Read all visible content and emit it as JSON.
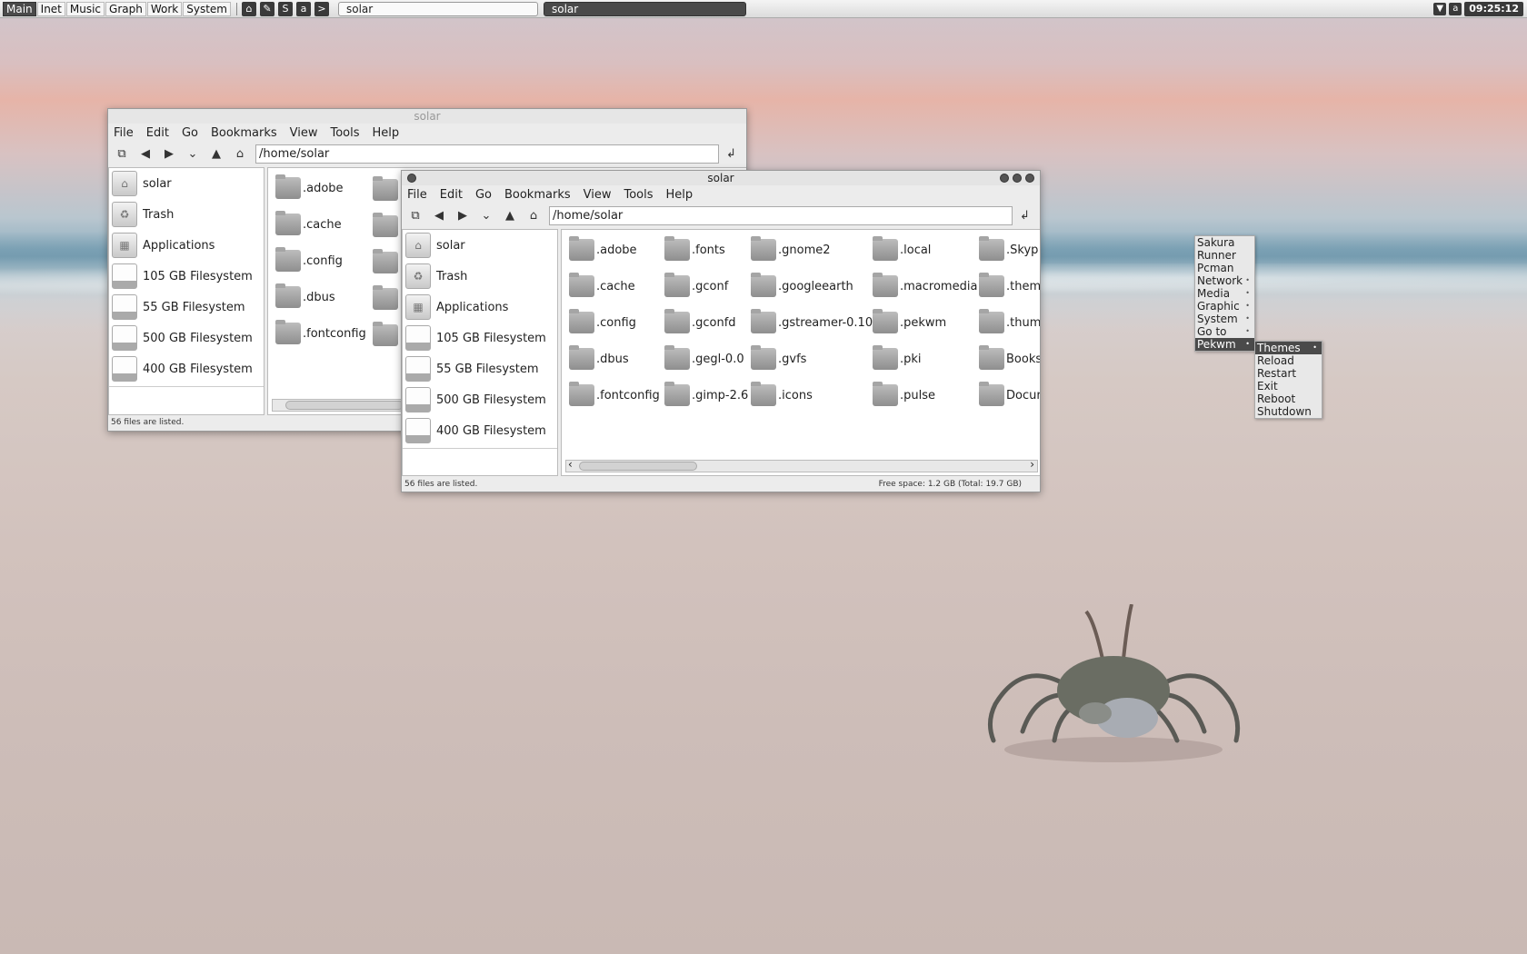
{
  "panel": {
    "workspaces": [
      "Main",
      "Inet",
      "Music",
      "Graph",
      "Work",
      "System"
    ],
    "launchers": [
      "home-icon",
      "edit-icon",
      "skype-icon",
      "amarok-icon",
      "terminal-icon"
    ],
    "launcher_glyphs": [
      "⌂",
      "✎",
      "S",
      "a",
      ">"
    ],
    "tasks": [
      "solar",
      "solar"
    ],
    "tray": [
      "dropdown-icon",
      "amarok-tray-icon"
    ],
    "tray_glyphs": [
      "▼",
      "a"
    ],
    "clock": "09:25:12"
  },
  "back_window": {
    "title": "solar",
    "menu": [
      "File",
      "Edit",
      "Go",
      "Bookmarks",
      "View",
      "Tools",
      "Help"
    ],
    "path": "/home/solar",
    "places": [
      "solar",
      "Trash",
      "Applications",
      "105 GB Filesystem",
      "55 GB Filesystem",
      "500 GB Filesystem",
      "400 GB Filesystem"
    ],
    "files": [
      ".adobe",
      ".cache",
      ".config",
      ".dbus",
      ".fontconfig"
    ],
    "status": "56 files are listed."
  },
  "front_window": {
    "title": "solar",
    "menu": [
      "File",
      "Edit",
      "Go",
      "Bookmarks",
      "View",
      "Tools",
      "Help"
    ],
    "path": "/home/solar",
    "places": [
      "solar",
      "Trash",
      "Applications",
      "105 GB Filesystem",
      "55 GB Filesystem",
      "500 GB Filesystem",
      "400 GB Filesystem"
    ],
    "files": [
      [
        ".adobe",
        ".cache",
        ".config",
        ".dbus",
        ".fontconfig"
      ],
      [
        ".fonts",
        ".gconf",
        ".gconfd",
        ".gegl-0.0",
        ".gimp-2.6"
      ],
      [
        ".gnome2",
        ".googleearth",
        ".gstreamer-0.10",
        ".gvfs",
        ".icons"
      ],
      [
        ".local",
        ".macromedia",
        ".pekwm",
        ".pki",
        ".pulse"
      ],
      [
        ".Skyp",
        ".them",
        ".thum",
        "Books",
        "Docur"
      ]
    ],
    "status": "56 files are listed.",
    "free_space": "Free space: 1.2 GB (Total: 19.7 GB)"
  },
  "root_menu": {
    "items": [
      "Sakura",
      "Runner",
      "Pcman",
      "Network",
      "Media",
      "Graphic",
      "System",
      "Go to",
      "Pekwm"
    ],
    "submenu_flags": [
      false,
      false,
      false,
      true,
      true,
      true,
      true,
      true,
      true
    ],
    "highlighted": "Pekwm"
  },
  "pekwm_menu": {
    "items": [
      "Themes",
      "Reload",
      "Restart",
      "Exit",
      "Reboot",
      "Shutdown"
    ]
  }
}
